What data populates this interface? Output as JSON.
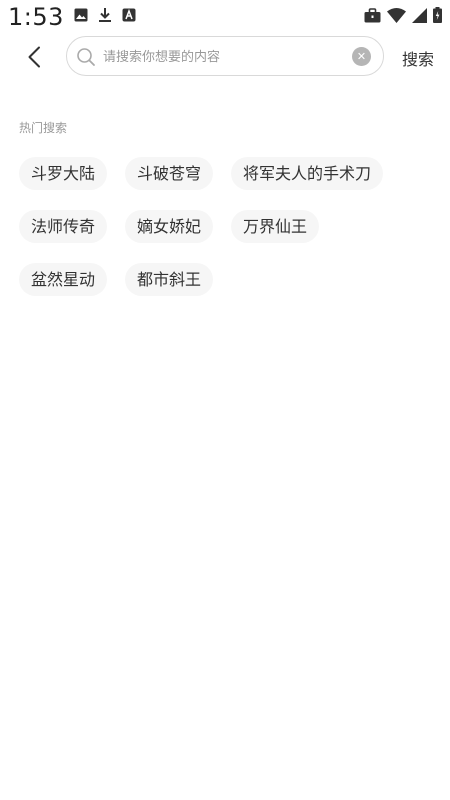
{
  "status_bar": {
    "time": "1:53",
    "left_icons": [
      "image-icon",
      "download-icon",
      "app-store-icon"
    ],
    "right_icons": [
      "briefcase-icon",
      "wifi-icon",
      "signal-icon",
      "battery-icon"
    ]
  },
  "search": {
    "placeholder": "请搜索你想要的内容",
    "value": "",
    "submit_label": "搜索"
  },
  "hot": {
    "title": "热门搜索",
    "rows": [
      [
        "斗罗大陆",
        "斗破苍穹",
        "将军夫人的手术刀"
      ],
      [
        "法师传奇",
        "嫡女娇妃",
        "万界仙王"
      ],
      [
        "盆然星动",
        "都市斜王"
      ]
    ]
  }
}
